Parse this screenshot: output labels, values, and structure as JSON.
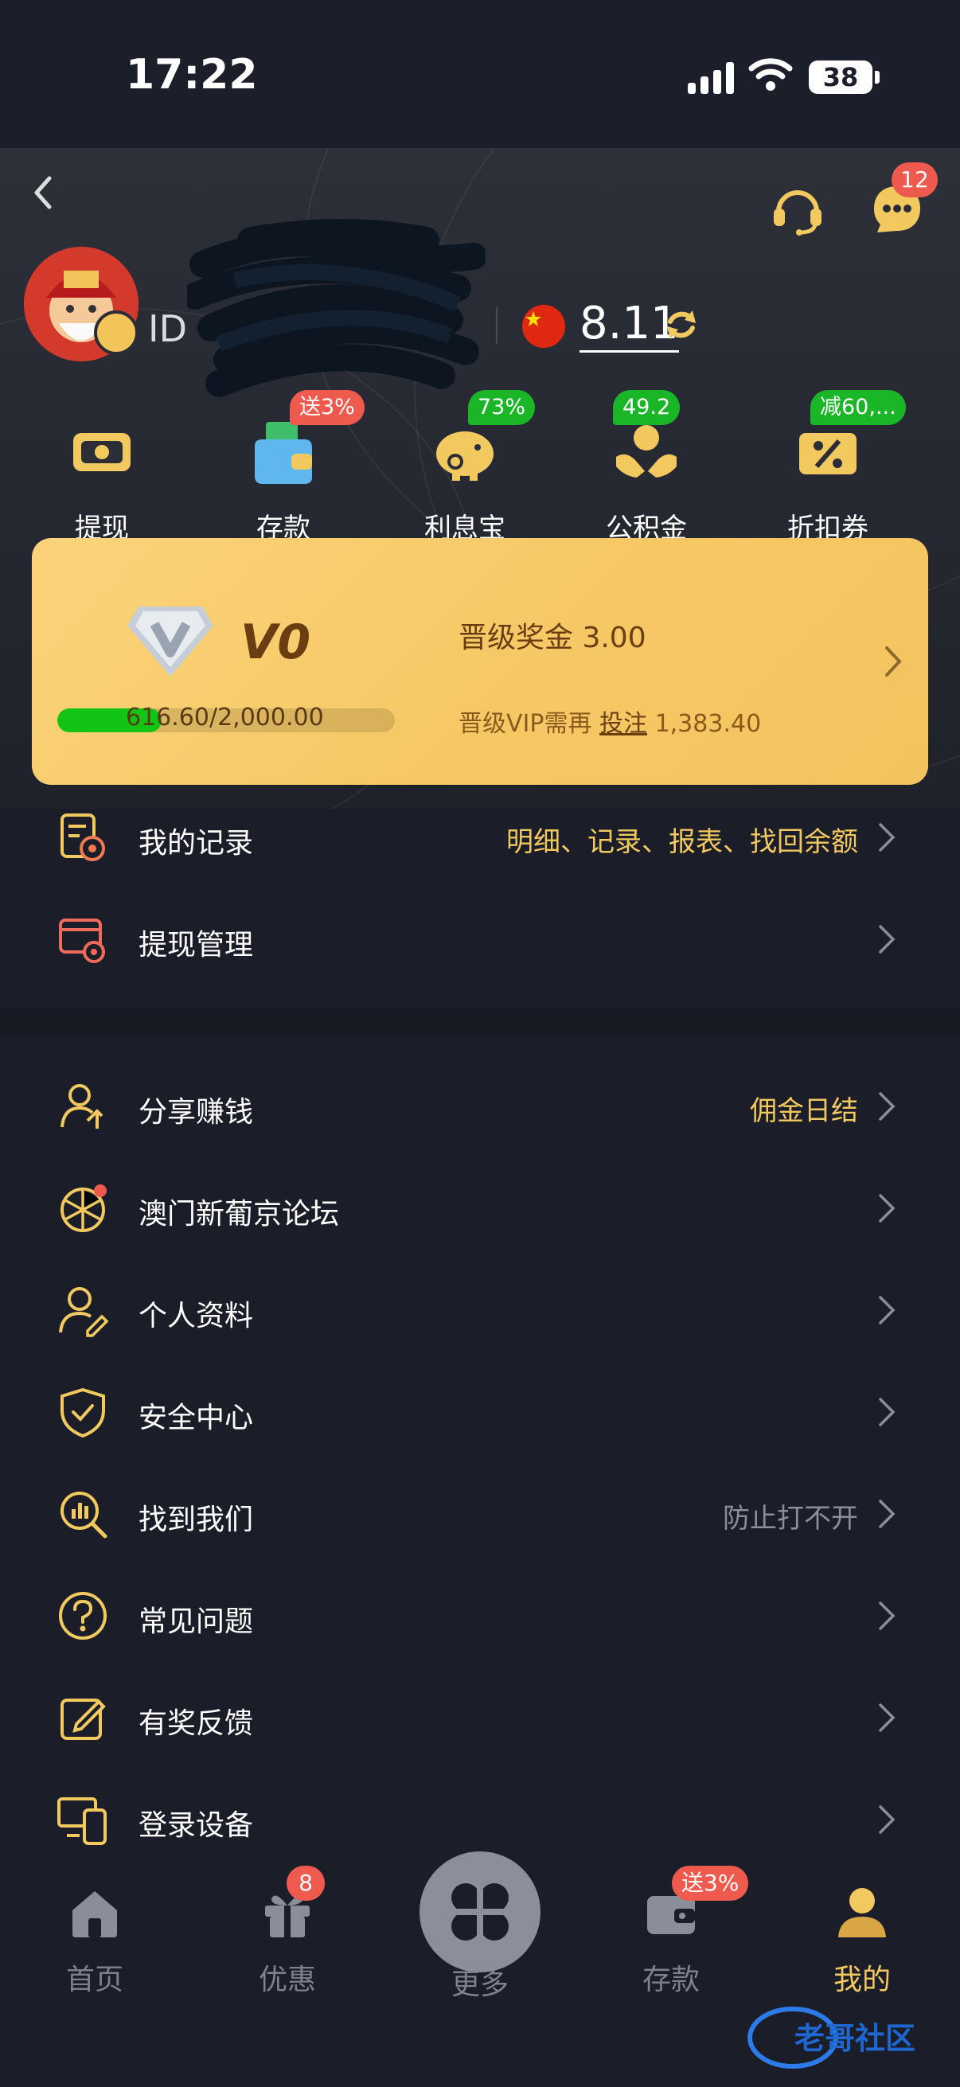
{
  "status": {
    "time": "17:22",
    "battery": "38"
  },
  "header": {
    "back_label": "back",
    "message_count": "12",
    "username_prefix": "ID",
    "balance": "8.11"
  },
  "quick_actions": [
    {
      "label": "提现",
      "badge": "",
      "icon": "withdraw-icon"
    },
    {
      "label": "存款",
      "badge": "送3%",
      "badge_color": "red",
      "icon": "deposit-icon"
    },
    {
      "label": "利息宝",
      "badge": "73%",
      "badge_color": "green",
      "icon": "piggy-bank-icon"
    },
    {
      "label": "公积金",
      "badge": "49.2",
      "badge_color": "green",
      "icon": "fund-icon"
    },
    {
      "label": "折扣券",
      "badge": "减60,...",
      "badge_color": "green",
      "icon": "coupon-icon"
    }
  ],
  "vip": {
    "level": "V0",
    "bonus_label": "晋级奖金 3.00",
    "progress_text": "616.60/2,000.00",
    "progress_fraction": 0.308,
    "need_prefix": "晋级VIP需再",
    "need_link": "投注",
    "need_amount": "1,383.40"
  },
  "menu": [
    {
      "label": "我的记录",
      "right": "明细、记录、报表、找回余额",
      "right_style": "gold",
      "icon": "records-icon"
    },
    {
      "label": "提现管理",
      "right": "",
      "icon": "withdraw-manage-icon"
    },
    {
      "label": "分享赚钱",
      "right": "佣金日结",
      "right_style": "gold",
      "icon": "share-earn-icon"
    },
    {
      "label": "澳门新葡京论坛",
      "right": "",
      "icon": "forum-icon"
    },
    {
      "label": "个人资料",
      "right": "",
      "icon": "profile-icon"
    },
    {
      "label": "安全中心",
      "right": "",
      "icon": "shield-icon"
    },
    {
      "label": "找到我们",
      "right": "防止打不开",
      "right_style": "gray",
      "icon": "find-us-icon"
    },
    {
      "label": "常见问题",
      "right": "",
      "icon": "question-icon"
    },
    {
      "label": "有奖反馈",
      "right": "",
      "icon": "feedback-icon"
    },
    {
      "label": "登录设备",
      "right": "",
      "icon": "devices-icon"
    }
  ],
  "tabs": [
    {
      "label": "首页",
      "icon": "home-icon"
    },
    {
      "label": "优惠",
      "badge": "8",
      "icon": "gift-icon"
    },
    {
      "label": "更多",
      "icon": "clover-icon"
    },
    {
      "label": "存款",
      "badge": "送3%",
      "icon": "wallet-icon"
    },
    {
      "label": "我的",
      "icon": "user-icon",
      "active": true
    }
  ],
  "colors": {
    "gold": "#f2c95f",
    "bg": "#1b1e28",
    "card": "#f6c865",
    "badge_red": "#ef5a4e",
    "badge_green": "#1bb628"
  }
}
